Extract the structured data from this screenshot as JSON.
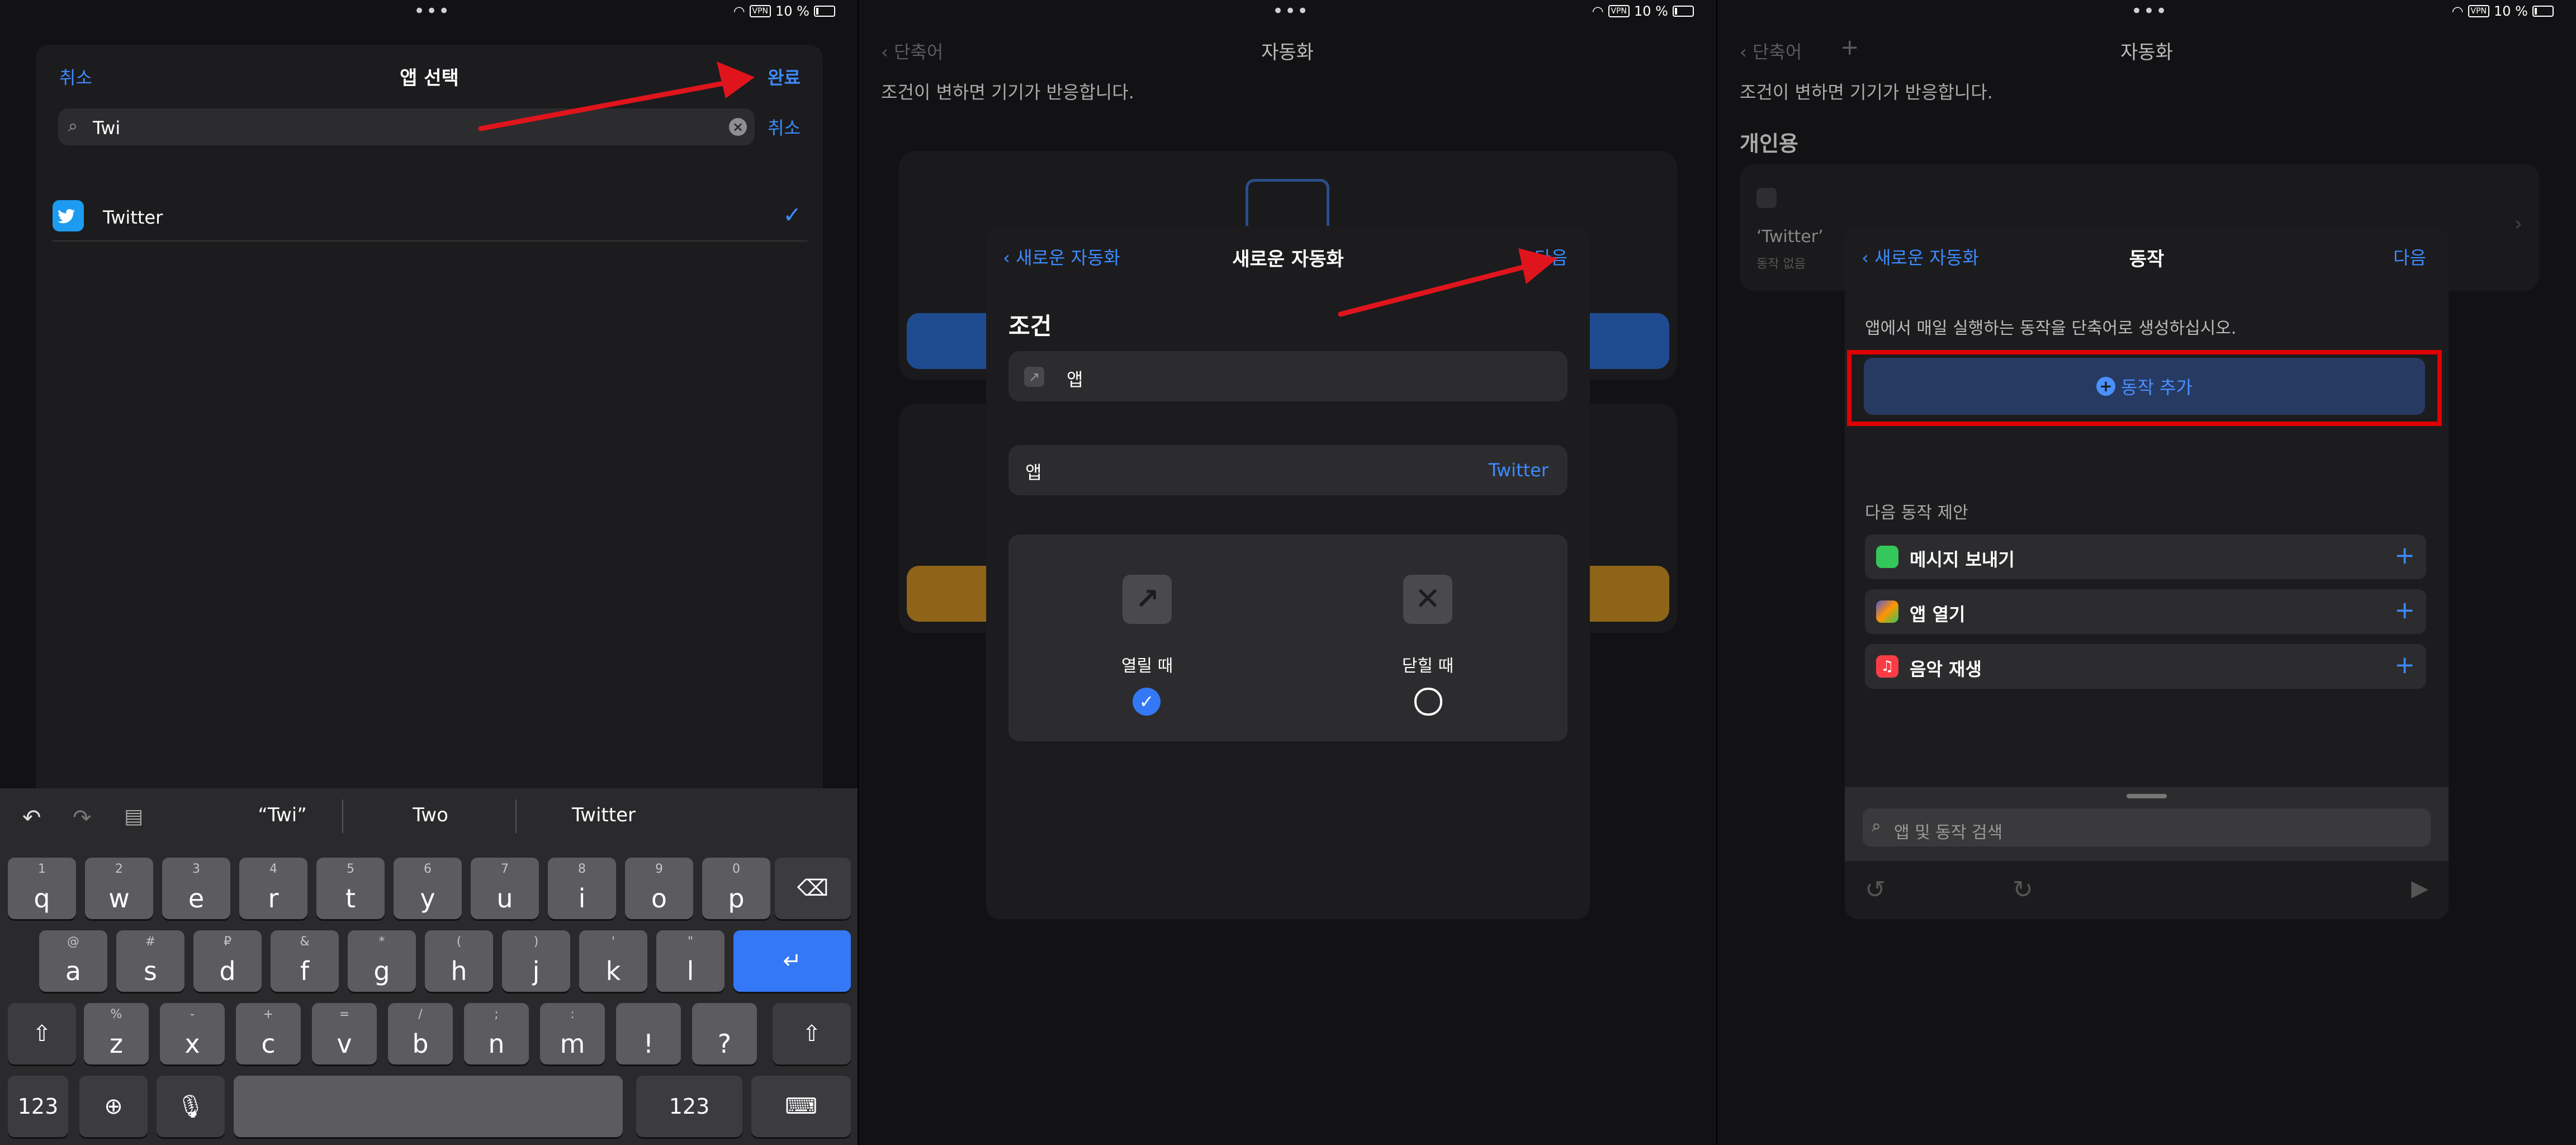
{
  "status": {
    "battery": "10 %",
    "vpn": "VPN"
  },
  "panel1": {
    "header": {
      "cancel": "취소",
      "title": "앱 선택",
      "done": "완료"
    },
    "search": {
      "value": "Twi",
      "cancel": "취소"
    },
    "result": {
      "label": "Twitter"
    },
    "suggestions": [
      "“Twi”",
      "Two",
      "Twitter"
    ],
    "keys_row1": [
      {
        "k": "q",
        "s": "1"
      },
      {
        "k": "w",
        "s": "2"
      },
      {
        "k": "e",
        "s": "3"
      },
      {
        "k": "r",
        "s": "4"
      },
      {
        "k": "t",
        "s": "5"
      },
      {
        "k": "y",
        "s": "6"
      },
      {
        "k": "u",
        "s": "7"
      },
      {
        "k": "i",
        "s": "8"
      },
      {
        "k": "o",
        "s": "9"
      },
      {
        "k": "p",
        "s": "0"
      }
    ],
    "keys_row2": [
      {
        "k": "a",
        "s": "@"
      },
      {
        "k": "s",
        "s": "#"
      },
      {
        "k": "d",
        "s": "₽"
      },
      {
        "k": "f",
        "s": "&"
      },
      {
        "k": "g",
        "s": "*"
      },
      {
        "k": "h",
        "s": "("
      },
      {
        "k": "j",
        "s": ")"
      },
      {
        "k": "k",
        "s": "'"
      },
      {
        "k": "l",
        "s": "\""
      }
    ],
    "keys_row3": [
      {
        "k": "z",
        "s": "%"
      },
      {
        "k": "x",
        "s": "-"
      },
      {
        "k": "c",
        "s": "+"
      },
      {
        "k": "v",
        "s": "="
      },
      {
        "k": "b",
        "s": "/"
      },
      {
        "k": "n",
        "s": ";"
      },
      {
        "k": "m",
        "s": ":"
      },
      {
        "k": "!",
        "s": ""
      },
      {
        "k": "?",
        "s": ""
      }
    ],
    "key_num": "123"
  },
  "panel2": {
    "nav": {
      "back": "단축어",
      "title": "자동화"
    },
    "subtitle": "조건이 변하면 기기가 반응합니다.",
    "sheet": {
      "back": "새로운 자동화",
      "title": "새로운 자동화",
      "next": "다음",
      "section": "조건",
      "app_row": "앱",
      "app_label": "앱",
      "app_value": "Twitter",
      "opened": "열릴 때",
      "closed": "닫힐 때"
    }
  },
  "panel3": {
    "nav": {
      "back": "단축어",
      "title": "자동화"
    },
    "subtitle": "조건이 변하면 기기가 반응합니다.",
    "section": "개인용",
    "bg_item_title": "‘Twitter’",
    "bg_item_sub": "동작 없음",
    "sheet": {
      "back": "새로운 자동화",
      "title": "동작",
      "next": "다음",
      "desc": "앱에서 매일 실행하는 동작을 단축어로 생성하십시오.",
      "add_action": "동작 추가",
      "suggest_header": "다음 동작 제안",
      "suggestions": [
        "메시지 보내기",
        "앱 열기",
        "음악 재생"
      ],
      "search_placeholder": "앱 및 동작 검색"
    }
  },
  "colors": {
    "accent": "#3d8bff",
    "arrow": "#e0141c",
    "highlight": "#e00000"
  }
}
